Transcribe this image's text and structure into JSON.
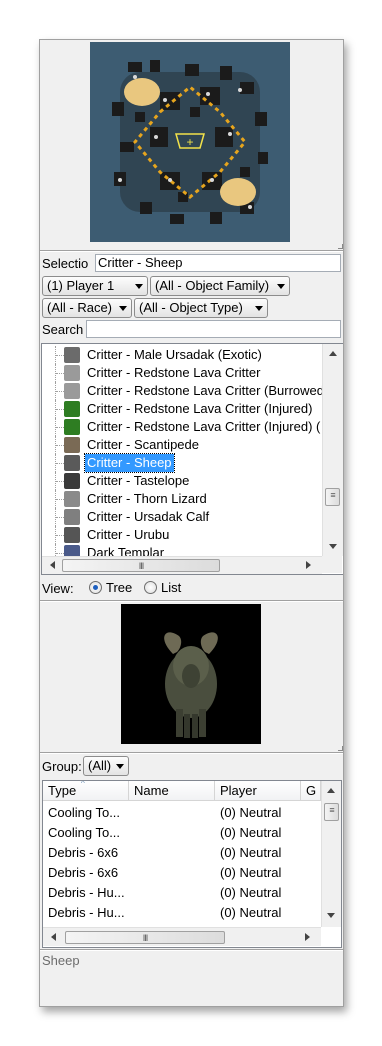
{
  "selection": {
    "label": "Selectio",
    "value": "Critter - Sheep"
  },
  "filters": {
    "player": "(1) Player 1",
    "object_family": "(All - Object Family)",
    "race": "(All - Race)",
    "object_type": "(All - Object Type)"
  },
  "search": {
    "label": "Search",
    "value": ""
  },
  "tree_items": [
    {
      "label": "Critter - Male Ursadak (Exotic)",
      "icon": "ursadak-exotic-icon",
      "color": "#6b6b6b"
    },
    {
      "label": "Critter - Redstone Lava Critter",
      "icon": "lava-critter-icon",
      "color": "#9a9a9a"
    },
    {
      "label": "Critter - Redstone Lava Critter (Burrowed)",
      "icon": "lava-critter-burrowed-icon",
      "color": "#9a9a9a"
    },
    {
      "label": "Critter - Redstone Lava Critter (Injured)",
      "icon": "lava-critter-injured-icon",
      "color": "#2e7d22"
    },
    {
      "label": "Critter - Redstone Lava Critter (Injured) (",
      "icon": "lava-critter-injured-2-icon",
      "color": "#2e7d22"
    },
    {
      "label": "Critter - Scantipede",
      "icon": "scantipede-icon",
      "color": "#7a6a55"
    },
    {
      "label": "Critter - Sheep",
      "icon": "sheep-icon",
      "color": "#5a5a5a",
      "selected": true
    },
    {
      "label": "Critter - Tastelope",
      "icon": "tastelope-icon",
      "color": "#3a3a3a"
    },
    {
      "label": "Critter - Thorn Lizard",
      "icon": "thorn-lizard-icon",
      "color": "#8a8a8a"
    },
    {
      "label": "Critter - Ursadak Calf",
      "icon": "ursadak-calf-icon",
      "color": "#7f7f7f"
    },
    {
      "label": "Critter - Urubu",
      "icon": "urubu-icon",
      "color": "#555555"
    },
    {
      "label": "Dark Templar",
      "icon": "dark-templar-icon",
      "color": "#4a5a8a"
    }
  ],
  "view": {
    "label": "View:",
    "tree_label": "Tree",
    "list_label": "List",
    "selected": "Tree"
  },
  "group": {
    "label": "Group:",
    "value": "(All)"
  },
  "grid": {
    "columns": [
      "Type",
      "Name",
      "Player",
      "G"
    ],
    "rows": [
      [
        "Cooling To...",
        "",
        "(0) Neutral"
      ],
      [
        "Cooling To...",
        "",
        "(0) Neutral"
      ],
      [
        "Debris - 6x6",
        "",
        "(0) Neutral"
      ],
      [
        "Debris - 6x6",
        "",
        "(0) Neutral"
      ],
      [
        "Debris - Hu...",
        "",
        "(0) Neutral"
      ],
      [
        "Debris - Hu...",
        "",
        "(0) Neutral"
      ]
    ]
  },
  "scroll_grip": "III",
  "status": "Sheep",
  "colors": {
    "minimap_bg": "#3d5c72",
    "selection": "#3399ff",
    "creep": "#e9c77f"
  }
}
